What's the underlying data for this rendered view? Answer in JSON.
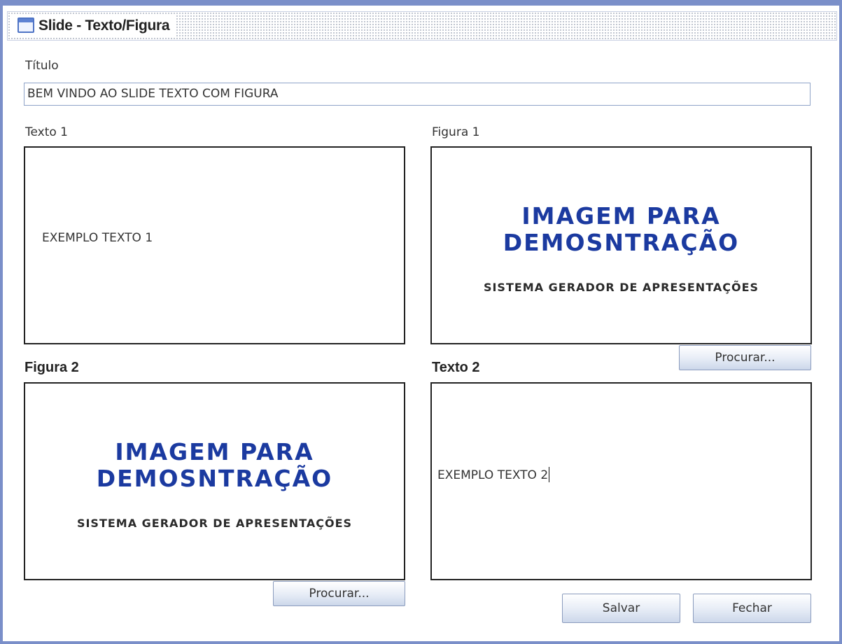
{
  "window": {
    "title": "Slide - Texto/Figura",
    "icon": "window-icon"
  },
  "titulo": {
    "label": "Título",
    "value": "BEM VINDO AO SLIDE TEXTO COM FIGURA"
  },
  "texto1": {
    "label": "Texto 1",
    "value": "EXEMPLO TEXTO 1"
  },
  "figura1": {
    "label": "Figura 1",
    "image_line1": "IMAGEM PARA",
    "image_line2": "DEMOSNTRAÇÃO",
    "image_line3": "SISTEMA GERADOR DE APRESENTAÇÕES",
    "browse_label": "Procurar..."
  },
  "figura2": {
    "label": "Figura 2",
    "image_line1": "IMAGEM PARA",
    "image_line2": "DEMOSNTRAÇÃO",
    "image_line3": "SISTEMA GERADOR DE APRESENTAÇÕES",
    "browse_label": "Procurar..."
  },
  "texto2": {
    "label": "Texto 2",
    "value": "EXEMPLO TEXTO 2"
  },
  "actions": {
    "save_label": "Salvar",
    "close_label": "Fechar"
  },
  "colors": {
    "window_border": "#7a8fc9",
    "image_heading": "#1b3aa0",
    "image_subtitle": "#2a2a2a"
  }
}
